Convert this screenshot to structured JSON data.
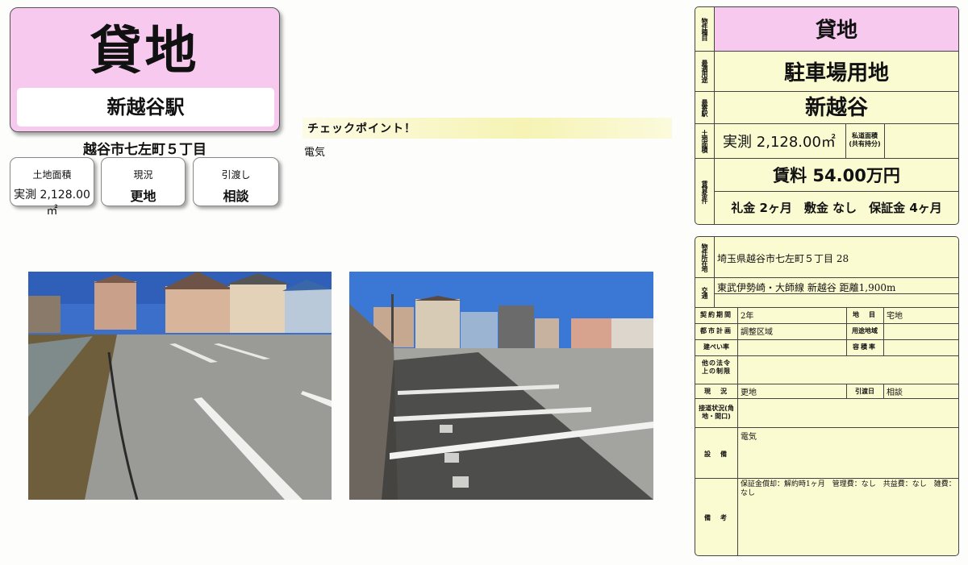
{
  "header": {
    "title": "貸地",
    "station": "新越谷駅",
    "address": "越谷市七左町５丁目"
  },
  "cards": [
    {
      "label": "土地面積",
      "value": "実測 2,128.00㎡"
    },
    {
      "label": "現況",
      "value": "更地"
    },
    {
      "label": "引渡し",
      "value": "相談"
    }
  ],
  "checkpoint": {
    "heading": "チェックポイント！",
    "text": "電気"
  },
  "summary": {
    "type_label": "物件種目",
    "type_value": "貸地",
    "use_label": "最適用途",
    "use_value": "駐車場用地",
    "station_label": "最寄駅",
    "station_value": "新越谷",
    "area_label": "土地面積",
    "area_value": "実測 2,128.00㎡",
    "private_road_label": "私道面積\n(共有持分)",
    "conditions_label": "賃貸条件",
    "rent": "賃料 54.00万円",
    "fees": "礼金 2ヶ月　敷金 なし　保証金 4ヶ月"
  },
  "details": {
    "location_label": "物件所在地",
    "location_value": "埼玉県越谷市七左町５丁目 28",
    "transport_label": "交通",
    "transport_value": "東武伊勢崎・大師線 新越谷 距離1,900m",
    "contract_label": "契約期間",
    "contract_value": "2年",
    "land_type_label": "地　目",
    "land_type_value": "宅地",
    "city_plan_label": "都市計画",
    "city_plan_value": "調整区域",
    "zone_label": "用途地域",
    "zone_value": "",
    "coverage_label": "建ぺい率",
    "coverage_value": "",
    "far_label": "容積率",
    "far_value": "",
    "other_law_label": "他の法令上の制限",
    "other_law_value": "",
    "status_label": "現　況",
    "status_value": "更地",
    "handover_label": "引渡日",
    "handover_value": "相談",
    "road_label": "接道状況(角地・間口)",
    "road_value": "",
    "facilities_label": "設　備",
    "facilities_value": "電気",
    "remarks_label": "備　考",
    "remarks_value": "保証金償却：解約時1ヶ月　管理費：なし　共益費：なし　雑費：なし"
  },
  "colors": {
    "title_bg": "#f7c9ef",
    "panel_bg": "#fbfbd2",
    "checkpoint_bg": "#f6f3b4"
  }
}
